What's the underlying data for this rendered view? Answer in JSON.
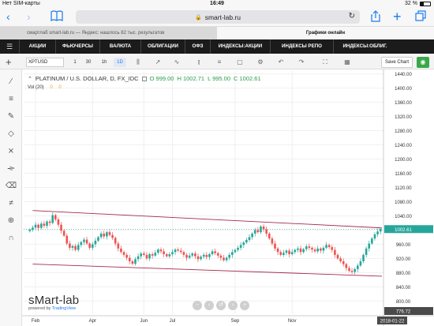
{
  "status": {
    "carrier": "Нет SIM-карты",
    "time": "16:49",
    "battery": "32 %",
    "battery_level": 0.32
  },
  "safari": {
    "url": "smart-lab.ru"
  },
  "tabs": [
    {
      "label": "смартлаб smart-lab.ru — Яндекс: нашлось 82 тыс. результатов"
    },
    {
      "label": "Графики онлайн"
    }
  ],
  "sitenav": [
    "АКЦИИ",
    "ФЬЮЧЕРСЫ",
    "ВАЛЮТА",
    "ОБЛИГАЦИИ",
    "ОФЗ",
    "ИНДЕКСЫ:АКЦИИ",
    "ИНДЕКСЫ РЕПО",
    "ИНДЕКСЫ:ОБЛИГ."
  ],
  "toolbar": {
    "symbol": "XPTUSD",
    "timeframes": [
      "1",
      "30",
      "1h",
      "1D"
    ],
    "active_timeframe": "1D",
    "save_label": "Save Chart"
  },
  "legend": {
    "title": "PLATINUM / U.S. DOLLAR, D, FX_IDC",
    "o": "O 999.00",
    "h": "H 1002.71",
    "l": "L 995.00",
    "c": "C 1002.61"
  },
  "volume": {
    "label": "Vol (20)",
    "v1": "0",
    "v2": "0"
  },
  "watermark": {
    "brand": "sMart-lab",
    "powered_prefix": "powered by",
    "powered_brand": "TradingView"
  },
  "colors": {
    "accent": "#1a7bf0",
    "up": "#26a69a",
    "down": "#ef5350",
    "channel": "#a3294c",
    "nav_bg": "#1b1b1b"
  },
  "chart_data": {
    "type": "candlestick",
    "title": "PLATINUM / U.S. DOLLAR, D, FX_IDC",
    "price_axis": [
      "1440.00",
      "1400.00",
      "1360.00",
      "1320.00",
      "1280.00",
      "1240.00",
      "1200.00",
      "1160.00",
      "1120.00",
      "1080.00",
      "1040.00",
      "1000.00",
      "960.00",
      "920.00",
      "880.00",
      "840.00",
      "800.00"
    ],
    "ylim": [
      763,
      1448
    ],
    "last_price": "1002.61",
    "last_price_bottom": "776.72",
    "time_axis": [
      "Feb",
      "Apr",
      "Jun",
      "Jul",
      "Sep",
      "Nov"
    ],
    "time_label": "2018-01-22",
    "closes": [
      1001,
      1007,
      1015,
      1006,
      1018,
      1012,
      1024,
      1020,
      1042,
      1030,
      1015,
      998,
      984,
      962,
      950,
      955,
      944,
      958,
      966,
      973,
      962,
      950,
      960,
      970,
      980,
      990,
      982,
      994,
      986,
      978,
      962,
      948,
      938,
      930,
      922,
      912,
      905,
      918,
      926,
      934,
      930,
      920,
      932,
      928,
      936,
      945,
      940,
      932,
      926,
      932,
      938,
      945,
      942,
      938,
      930,
      922,
      928,
      934,
      926,
      918,
      925,
      930,
      924,
      932,
      940,
      935,
      928,
      922,
      915,
      922,
      930,
      938,
      944,
      950,
      958,
      965,
      972,
      980,
      990,
      1000,
      994,
      1010,
      1002,
      990,
      976,
      962,
      948,
      938,
      930,
      936,
      942,
      932,
      938,
      944,
      948,
      938,
      946,
      954,
      950,
      945,
      940,
      948,
      942,
      950,
      958,
      952,
      944,
      930,
      920,
      912,
      904,
      893,
      885,
      882,
      890,
      900,
      912,
      930,
      948,
      962,
      976,
      988,
      996,
      1003
    ]
  },
  "channel": {
    "upper": [
      [
        1,
        1055
      ],
      [
        104,
        1006
      ]
    ],
    "lower": [
      [
        1,
        904
      ],
      [
        104,
        870
      ]
    ]
  }
}
